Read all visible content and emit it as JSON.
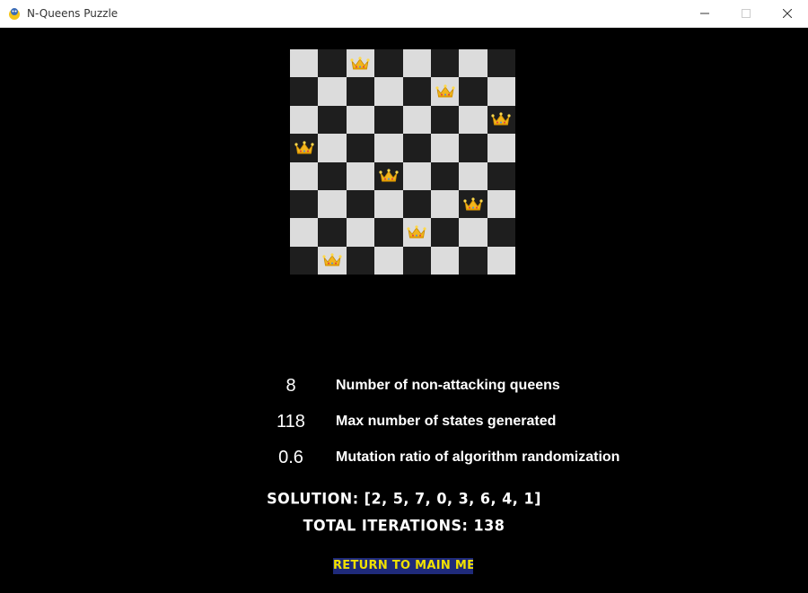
{
  "window": {
    "title": "N-Queens Puzzle"
  },
  "board": {
    "size": 8,
    "queens": [
      2,
      5,
      7,
      0,
      3,
      6,
      4,
      1
    ],
    "piece_icon": "crown-icon",
    "colors": {
      "light": "#dcdcdc",
      "dark": "#1e1e1e",
      "crown": "#f2b51c"
    }
  },
  "params": [
    {
      "value": "8",
      "label": "Number of non-attacking queens"
    },
    {
      "value": "118",
      "label": "Max number of states generated"
    },
    {
      "value": "0.6",
      "label": "Mutation ratio of algorithm randomization"
    }
  ],
  "result": {
    "solution": "SOLUTION: [2, 5, 7, 0, 3, 6, 4, 1]",
    "iterations": "TOTAL ITERATIONS: 138"
  },
  "actions": {
    "return_label": "RETURN TO MAIN MENU"
  },
  "colors": {
    "background": "#000000",
    "button_bg": "#1f2a7a",
    "button_text": "#f0e000"
  }
}
